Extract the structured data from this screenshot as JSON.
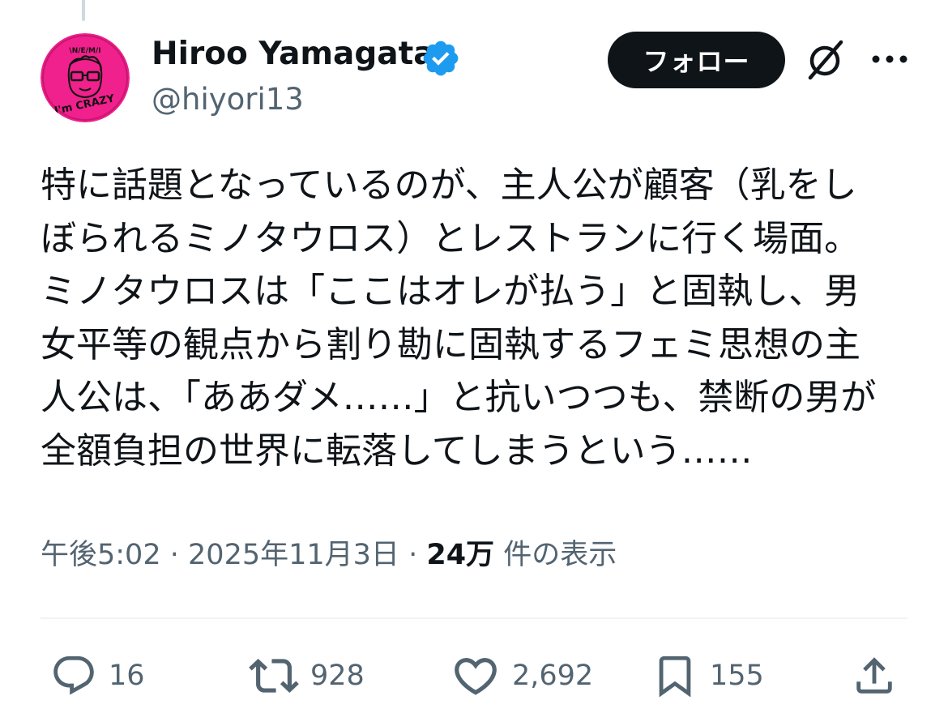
{
  "author": {
    "display_name": "Hiroo Yamagata",
    "handle": "@hiyori13",
    "verified": true,
    "avatar": {
      "text_top": "\\N/E/M/I",
      "text_bottom": "I'm CRAZY",
      "color": "#f0208c"
    }
  },
  "header": {
    "follow_label": "フォロー",
    "icons": [
      "grok-icon",
      "more-icon"
    ]
  },
  "tweet": {
    "text": "特に話題となっているのが、主人公が顧客（乳をし\nぼられるミノタウロス）とレストランに行く場面。\nミノタウロスは「ここはオレが払う」と固執し、男\n女平等の観点から割り勘に固執するフェミ思想の主\n人公は、「ああダメ……」と抗いつつも、禁断の男が\n全額負担の世界に転落してしまうという……",
    "time": "午後5:02",
    "separator": "·",
    "date": "2025年11月3日",
    "views_count": "24万",
    "views_label": "件の表示"
  },
  "actions": {
    "reply": {
      "icon": "reply-icon",
      "count": "16"
    },
    "retweet": {
      "icon": "retweet-icon",
      "count": "928"
    },
    "like": {
      "icon": "heart-icon",
      "count": "2,692"
    },
    "bookmark": {
      "icon": "bookmark-icon",
      "count": "155"
    },
    "share": {
      "icon": "share-icon"
    }
  },
  "colors": {
    "text": "#0f1419",
    "secondary": "#536471",
    "verified": "#1d9bf0",
    "divider": "#eff3f4"
  }
}
